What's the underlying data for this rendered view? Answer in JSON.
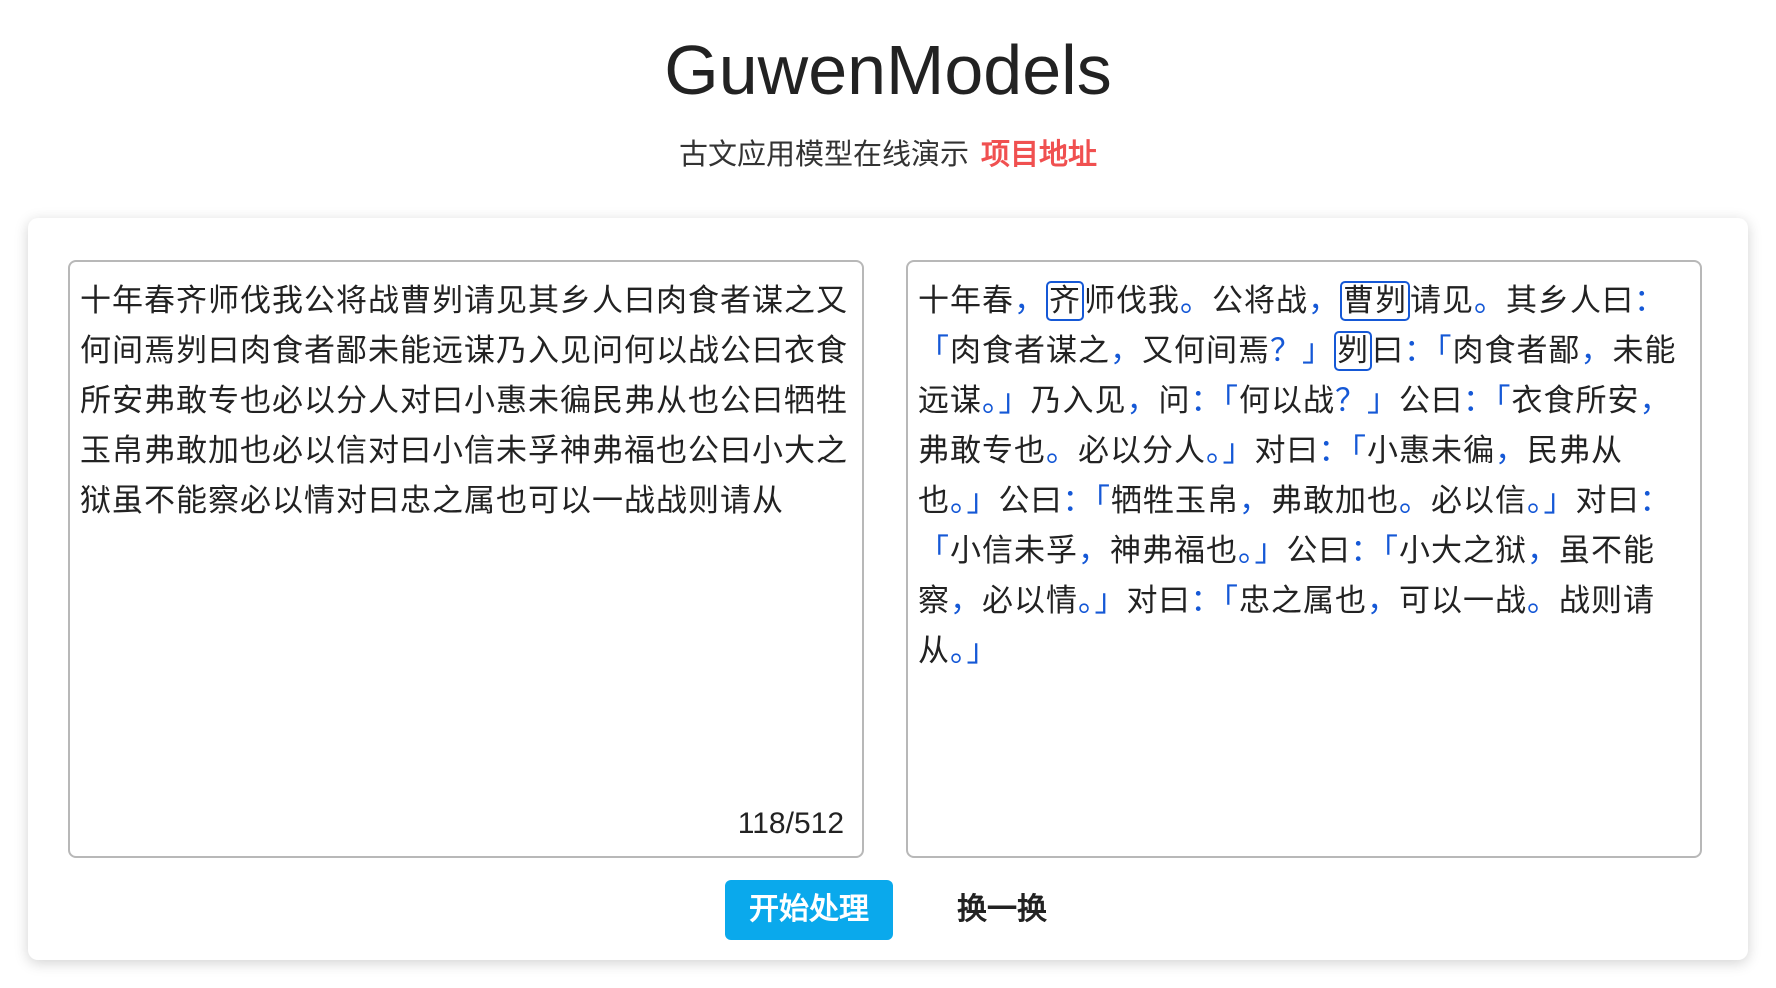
{
  "header": {
    "title": "GuwenModels",
    "subtitle": "古文应用模型在线演示",
    "link_label": "项目地址"
  },
  "input": {
    "text": "十年春齐师伐我公将战曹刿请见其乡人曰肉食者谋之又何间焉刿曰肉食者鄙未能远谋乃入见问何以战公曰衣食所安弗敢专也必以分人对曰小惠未徧民弗从也公曰牺牲玉帛弗敢加也必以信对曰小信未孚神弗福也公曰小大之狱虽不能察必以情对曰忠之属也可以一战战则请从",
    "counter": "118/512"
  },
  "output": {
    "segments": [
      {
        "t": "十年春"
      },
      {
        "t": "，",
        "c": "p"
      },
      {
        "t": "齐",
        "c": "ent"
      },
      {
        "t": "师伐我"
      },
      {
        "t": "。",
        "c": "p"
      },
      {
        "t": "公将战"
      },
      {
        "t": "，",
        "c": "p"
      },
      {
        "t": "曹刿",
        "c": "ent"
      },
      {
        "t": "请见"
      },
      {
        "t": "。",
        "c": "p"
      },
      {
        "t": "其乡人曰"
      },
      {
        "t": "：「",
        "c": "p"
      },
      {
        "t": "肉食者谋之"
      },
      {
        "t": "，",
        "c": "p"
      },
      {
        "t": "又何间焉"
      },
      {
        "t": "？」",
        "c": "p"
      },
      {
        "t": "刿",
        "c": "ent"
      },
      {
        "t": "曰"
      },
      {
        "t": "：「",
        "c": "p"
      },
      {
        "t": "肉食者鄙"
      },
      {
        "t": "，",
        "c": "p"
      },
      {
        "t": "未能远谋"
      },
      {
        "t": "。」",
        "c": "p"
      },
      {
        "t": "乃入见"
      },
      {
        "t": "，",
        "c": "p"
      },
      {
        "t": "问"
      },
      {
        "t": "：「",
        "c": "p"
      },
      {
        "t": "何以战"
      },
      {
        "t": "？」",
        "c": "p"
      },
      {
        "t": "公曰"
      },
      {
        "t": "：「",
        "c": "p"
      },
      {
        "t": "衣食所安"
      },
      {
        "t": "，",
        "c": "p"
      },
      {
        "t": "弗敢专也"
      },
      {
        "t": "。",
        "c": "p"
      },
      {
        "t": "必以分人"
      },
      {
        "t": "。」",
        "c": "p"
      },
      {
        "t": "对曰"
      },
      {
        "t": "：「",
        "c": "p"
      },
      {
        "t": "小惠未徧"
      },
      {
        "t": "，",
        "c": "p"
      },
      {
        "t": "民弗从也"
      },
      {
        "t": "。」",
        "c": "p"
      },
      {
        "t": "公曰"
      },
      {
        "t": "：「",
        "c": "p"
      },
      {
        "t": "牺牲玉帛"
      },
      {
        "t": "，",
        "c": "p"
      },
      {
        "t": "弗敢加也"
      },
      {
        "t": "。",
        "c": "p"
      },
      {
        "t": "必以信"
      },
      {
        "t": "。」",
        "c": "p"
      },
      {
        "t": "对曰"
      },
      {
        "t": "：「",
        "c": "p"
      },
      {
        "t": "小信未孚"
      },
      {
        "t": "，",
        "c": "p"
      },
      {
        "t": "神弗福也"
      },
      {
        "t": "。」",
        "c": "p"
      },
      {
        "t": "公曰"
      },
      {
        "t": "：「",
        "c": "p"
      },
      {
        "t": "小大之狱"
      },
      {
        "t": "，",
        "c": "p"
      },
      {
        "t": "虽不能察"
      },
      {
        "t": "，",
        "c": "p"
      },
      {
        "t": "必以情"
      },
      {
        "t": "。」",
        "c": "p"
      },
      {
        "t": "对曰"
      },
      {
        "t": "：「",
        "c": "p"
      },
      {
        "t": "忠之属也"
      },
      {
        "t": "，",
        "c": "p"
      },
      {
        "t": "可以一战"
      },
      {
        "t": "。",
        "c": "p"
      },
      {
        "t": "战则请从"
      },
      {
        "t": "。」",
        "c": "p"
      }
    ]
  },
  "actions": {
    "start_label": "开始处理",
    "swap_label": "换一换"
  },
  "colors": {
    "accent": "#0aa9ec",
    "link": "#f05050",
    "punctuation": "#1558d6"
  }
}
